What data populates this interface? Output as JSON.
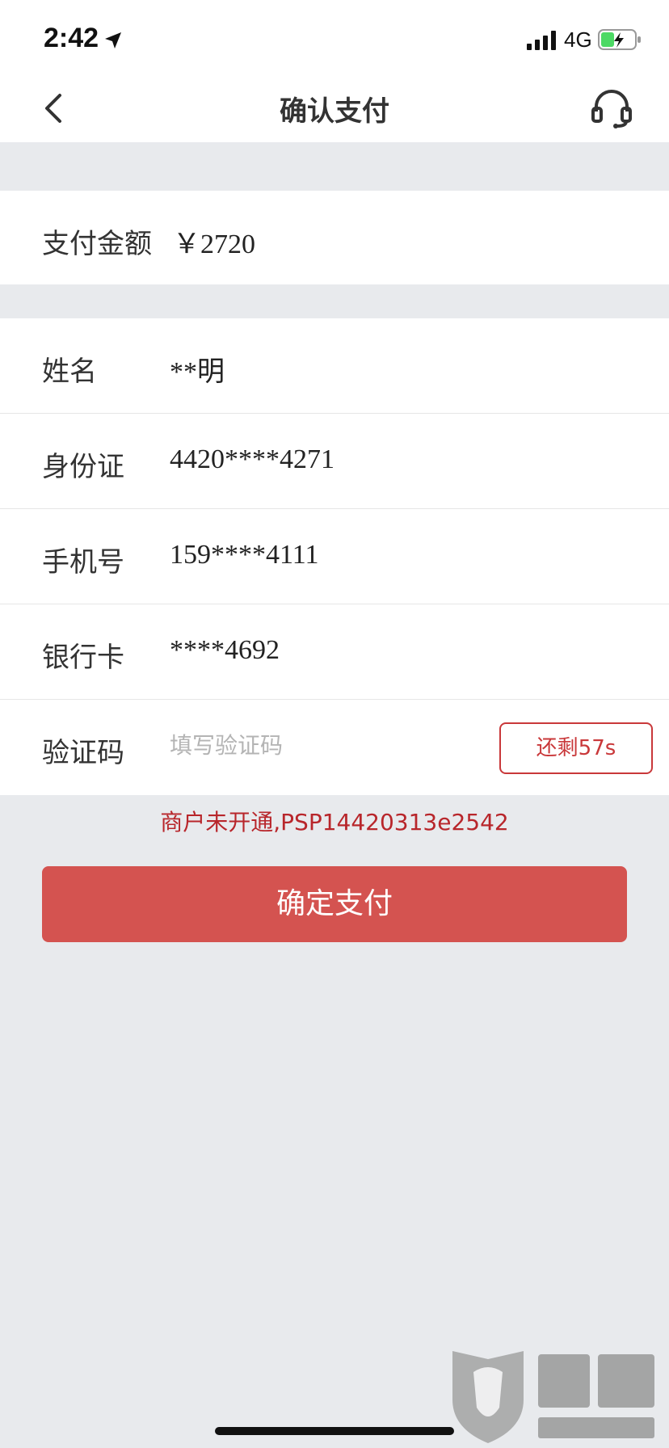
{
  "status_bar": {
    "time": "2:42",
    "network": "4G",
    "icons": [
      "location-arrow-icon",
      "signal-bars-icon",
      "battery-charging-icon"
    ]
  },
  "nav": {
    "title": "确认支付",
    "icons": [
      "back-chevron-icon",
      "customer-service-headset-icon"
    ]
  },
  "payment": {
    "amount_label": "支付金额",
    "amount_value": "￥2720"
  },
  "fields": {
    "name_label": "姓名",
    "name_value": "**明",
    "id_label": "身份证",
    "id_value": "4420****4271",
    "phone_label": "手机号",
    "phone_value": "159****4111",
    "card_label": "银行卡",
    "card_value": "****4692",
    "code_label": "验证码",
    "code_placeholder": "填写验证码",
    "code_value": "",
    "countdown_label": "还剩57s"
  },
  "error_message": "商户未开通,PSP14420313e2542",
  "confirm_button_label": "确定支付",
  "watermark": {
    "logo_text": "黑猫",
    "logo_subtext": "BLACK CAT"
  },
  "colors": {
    "accent_red": "#d45350",
    "error_red": "#b8262b",
    "background": "#e8eaed"
  }
}
